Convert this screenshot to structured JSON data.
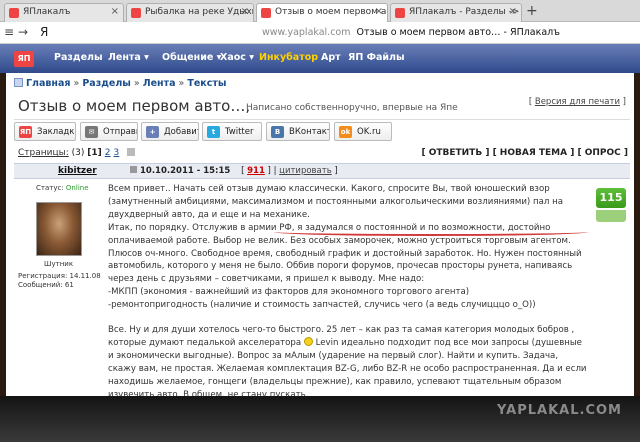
{
  "browser": {
    "tabs": [
      {
        "label": "ЯПлакалъ",
        "color": "#e44"
      },
      {
        "label": "Рыбалка на реке Удыхын…",
        "color": "#e44"
      },
      {
        "label": "Отзыв о моем первом а…",
        "color": "#e44"
      },
      {
        "label": "ЯПлакалъ - Разделы -> Ре…",
        "color": "#e44"
      }
    ],
    "new_tab": "+",
    "nav_menu": "≡",
    "nav_back": "→",
    "ya_logo": "Я",
    "url_domain": "www.yaplakal.com",
    "url_title": "Отзыв о моем первом авто… - ЯПлакалъ"
  },
  "sitenav": {
    "logo": "ЯП",
    "items": [
      "Разделы",
      "Лента ▾",
      "Общение ▾",
      "Хаос ▾",
      "Инкубатор",
      "Арт",
      "ЯП Файлы"
    ],
    "highlight_color": "#ffd200"
  },
  "breadcrumbs": {
    "items": [
      "Главная",
      "Разделы",
      "Лента",
      "Тексты"
    ],
    "sep": "»"
  },
  "topic": {
    "title": "Отзыв о моем первом авто…,",
    "subtitle": "Написано собственноручно, впервые на Япе",
    "version_open": "[ ",
    "version_link": "Версия для печати",
    "version_close": " ]"
  },
  "share": [
    {
      "label": "Закладки",
      "icon": "ЯП",
      "color": "#e44"
    },
    {
      "label": "Отправить",
      "icon": "✉",
      "color": "#777"
    },
    {
      "label": "Добавить в",
      "icon": "+",
      "color": "#6a7fb8"
    },
    {
      "label": "Twitter",
      "icon": "t",
      "color": "#29a9e0"
    },
    {
      "label": "ВКонтакте",
      "icon": "В",
      "color": "#4a76a8"
    },
    {
      "label": "OK.ru",
      "icon": "ok",
      "color": "#f28c1a"
    }
  ],
  "pages": {
    "label": "Страницы:",
    "count": "(3)",
    "current": "[1]",
    "p2": "2",
    "p3": "3"
  },
  "actions": "[ ОТВЕТИТЬ ] [ НОВАЯ ТЕМА ] [ ОПРОС ]",
  "post": {
    "author": "kibitzer",
    "date": "10.10.2011 - 15:15",
    "num": "911",
    "quote": "цитировать",
    "status_label": "Статус:",
    "status_value": "Online",
    "rank": "Шутник",
    "reg_line": "Регистрация: 14.11.08",
    "posts_line": "Сообщений: 61",
    "rating": "115",
    "paragraphs": [
      "Всем привет.. Начать сей отзыв думаю классически. Какого, спросите Вы, твой юношеский взор (замутненный амбициями, максимализмом и постоянными алкогольическими возлияниями) пал на двухдверный авто, да и еще и на механике.",
      "Итак, по порядку. Отслужив в армии РФ, я задумался о постоянной и по возможности, достойно оплачиваемой работе. Выбор не велик. Без особых заморочек, можно устроиться торговым агентом. Плюсов оч-много. Свободное время, свободный график и достойный заработок. Но. Нужен постоянный автомобиль, которого у меня не было. Оббив пороги форумов, прочесав просторы рунета, напиваясь через день с друзьями – советчиками, я пришел к выводу. Мне надо:",
      "-МКПП (экономия - важнейший из факторов для экономного торгового агента)",
      "-ремонтопригодность (наличие и стоимость запчастей, случись чего (а ведь случицццо о_О))"
    ],
    "p5_before": "Все. Ну и для души хотелось чего-то быстрого. 25 лет – как раз та самая категория молодых бобров , которые думают педалькой акселератора",
    "p5_after": "Levin идеально подходит под все мои запросы (душевные и экономически выгодные). Вопрос за мАлым (ударение на первый слог). Найти и купить. Задача, скажу вам, не простая. Желаемая комплектация BZ-G, либо BZ-R не особо распространенная. Да и если находишь желаемое, гонщеги (владельцы прежние), как правило, успевают тщательным образом изувечить авто. В общем, не стану пускать"
  },
  "watermark": "YAPLAKAL.COM"
}
